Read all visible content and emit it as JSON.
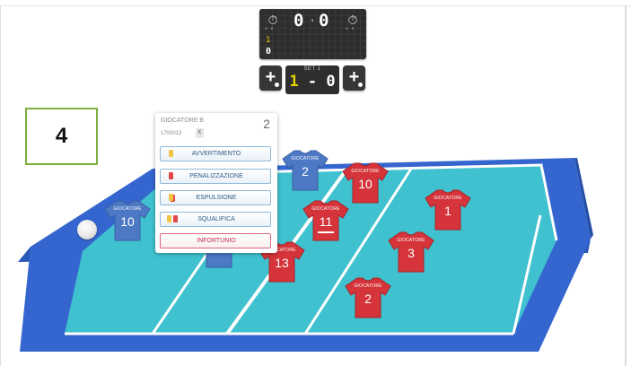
{
  "step": {
    "label": "4"
  },
  "scoreboard": {
    "team_left_score": "0",
    "team_right_score": "0",
    "set_indicator_top": "1",
    "set_indicator_bottom": "0",
    "set_label": "SET 1",
    "set_left": "1",
    "set_right": "0",
    "colors": {
      "digit": "#ffffff",
      "set_accent": "#e6d200",
      "panel": "#2d2d2d"
    }
  },
  "popup": {
    "title": "GIOCATORE B",
    "count": "2",
    "player_id": "1700013",
    "badge": "K",
    "actions": [
      {
        "label": "AVVERTIMENTO",
        "cards": [
          "yellow"
        ]
      },
      {
        "label": "PENALIZZAZIONE",
        "cards": [
          "red"
        ]
      },
      {
        "label": "ESPULSIONE",
        "cards": [
          "yellow-red"
        ]
      },
      {
        "label": "SQUALIFICA",
        "cards": [
          "yellow",
          "red"
        ]
      },
      {
        "label": "INFORTUNIO",
        "cards": []
      }
    ]
  },
  "players": {
    "blue": [
      {
        "label": "GIOCATORE",
        "number": "10"
      },
      {
        "label": "GIOCATORE",
        "number": "2"
      },
      {
        "label": "",
        "number": ""
      }
    ],
    "red": [
      {
        "label": "GIOCATORE",
        "number": "10"
      },
      {
        "label": "GIOCATORE",
        "number": "11"
      },
      {
        "label": "GIOCATORE",
        "number": "1"
      },
      {
        "label": "GIOCATORE",
        "number": "3"
      },
      {
        "label": "GIOCATORE",
        "number": "13"
      },
      {
        "label": "GIOCATORE",
        "number": "2"
      }
    ]
  },
  "colors": {
    "court": "#3fc1cf",
    "court_base": "#2f62c7",
    "team_blue": "#4d78c4",
    "team_red": "#d4343a",
    "popup_button_border": "#8fb8d8",
    "popup_danger": "#c02d45"
  }
}
